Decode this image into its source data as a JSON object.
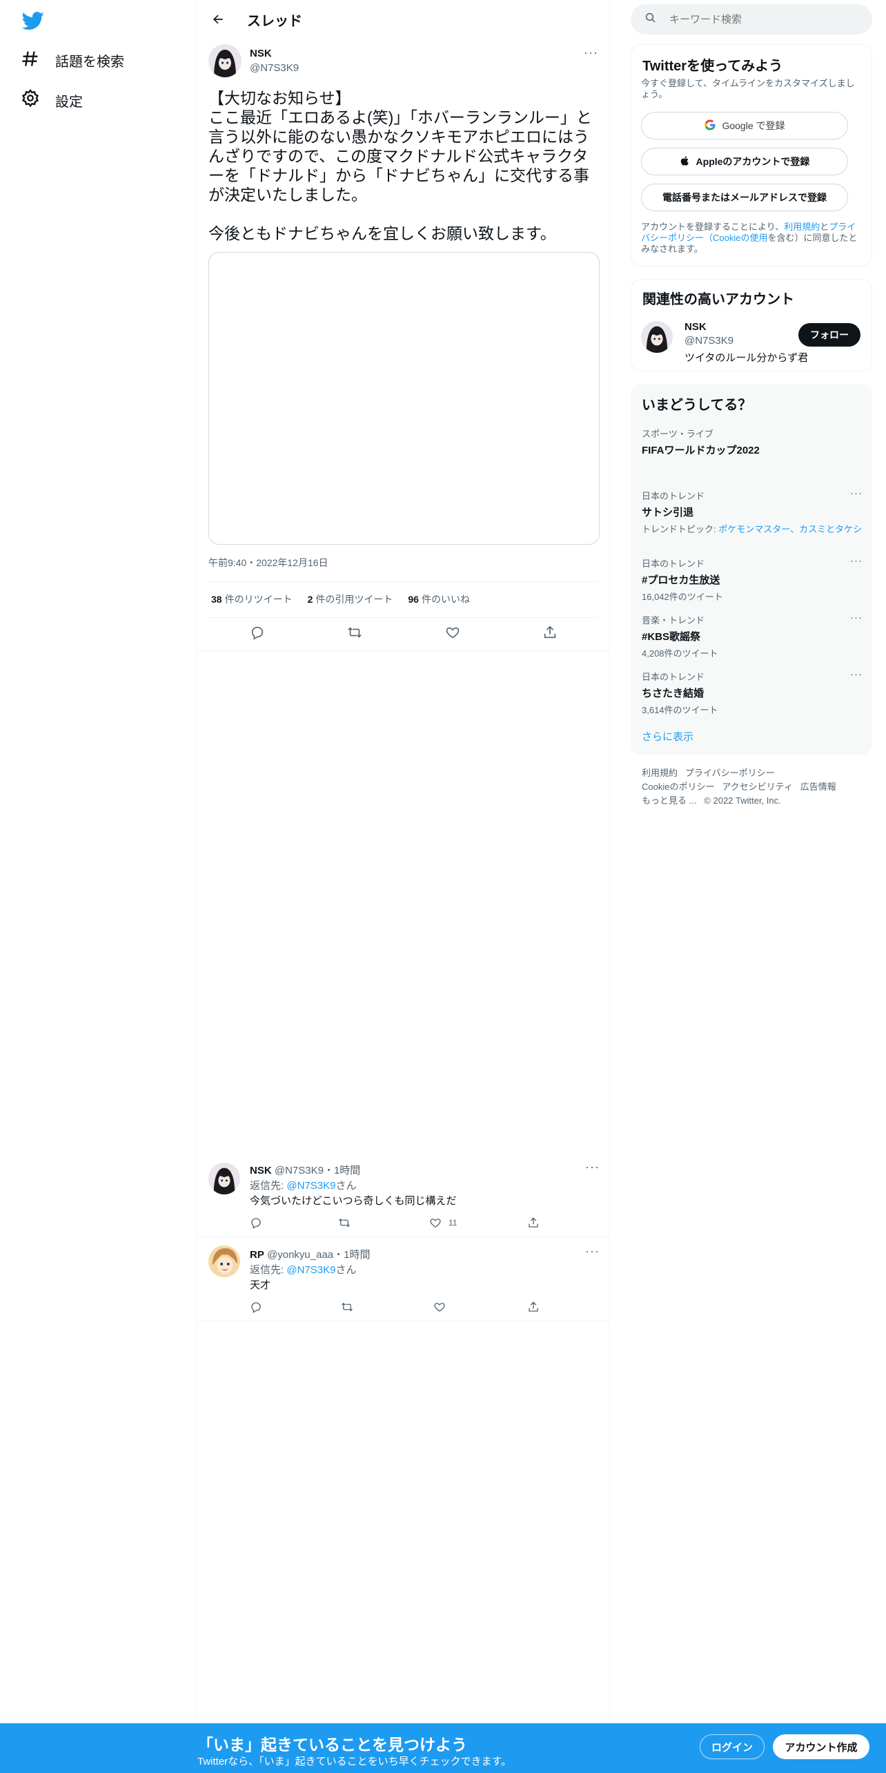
{
  "nav": {
    "explore_label": "話題を検索",
    "settings_label": "設定"
  },
  "thread": {
    "title": "スレッド",
    "tweet": {
      "name": "NSK",
      "handle": "@N7S3K9",
      "text_p1": "【大切なお知らせ】\nここ最近「エロあるよ(笑)」「ホバーランランルー」と言う以外に能のない愚かなクソキモアホピエロにはうんざりですので、この度マクドナルド公式キャラクターを「ドナルド」から「ドナビちゃん」に交代する事が決定いたしました。",
      "text_p2": "今後ともドナビちゃんを宜しくお願い致します。",
      "timestamp": "午前9:40・2022年12月16日",
      "retweets_count": "38",
      "retweets_label": "件のリツイート",
      "quotes_count": "2",
      "quotes_label": "件の引用ツイート",
      "likes_count": "96",
      "likes_label": "件のいいね"
    },
    "replies": [
      {
        "name": "NSK",
        "handle": "@N7S3K9",
        "time": "・1時間",
        "reply_to_prefix": "返信先: ",
        "reply_to_mention": "@N7S3K9",
        "reply_to_suffix": "さん",
        "text": "今気づいたけどこいつら奇しくも同じ構えだ",
        "likes": "11"
      },
      {
        "name": "RP",
        "handle": "@yonkyu_aaa",
        "time": "・1時間",
        "reply_to_prefix": "返信先: ",
        "reply_to_mention": "@N7S3K9",
        "reply_to_suffix": "さん",
        "text": "天才",
        "likes": ""
      }
    ]
  },
  "search": {
    "placeholder": "キーワード検索"
  },
  "signup_card": {
    "title": "Twitterを使ってみよう",
    "subtitle": "今すぐ登録して、タイムラインをカスタマイズしましょう。",
    "google_label": "Google で登録",
    "apple_label": "Appleのアカウントで登録",
    "phone_label": "電話番号またはメールアドレスで登録",
    "terms_prefix": "アカウントを登録することにより、",
    "terms_link": "利用規約",
    "terms_and": "と",
    "privacy_link": "プライバシーポリシー",
    "cookie_prefix": "（",
    "cookie_link": "Cookieの使用",
    "terms_suffix": "を含む）に同意したとみなされます。"
  },
  "relevant_card": {
    "title": "関連性の高いアカウント",
    "name": "NSK",
    "handle": "@N7S3K9",
    "bio": "ツイタのルール分からず君",
    "follow_label": "フォロー"
  },
  "trends_card": {
    "title": "いまどうしてる？",
    "items": [
      {
        "category": "スポーツ・ライブ",
        "name": "FIFAワールドカップ2022",
        "count": ""
      },
      {
        "category": "日本のトレンド",
        "name": "サトシ引退",
        "topic_prefix": "トレンドトピック: ",
        "topic_links": "ポケモンマスター、カスミとタケシ",
        "count": ""
      },
      {
        "category": "日本のトレンド",
        "name": "#プロセカ生放送",
        "count": "16,042件のツイート"
      },
      {
        "category": "音楽・トレンド",
        "name": "#KBS歌謡祭",
        "count": "4,208件のツイート"
      },
      {
        "category": "日本のトレンド",
        "name": "ちさたき結婚",
        "count": "3,614件のツイート"
      }
    ],
    "show_more": "さらに表示"
  },
  "footer": {
    "terms": "利用規約",
    "privacy": "プライバシーポリシー",
    "cookie": "Cookieのポリシー",
    "accessibility": "アクセシビリティ",
    "ads": "広告情報",
    "more": "もっと見る ...",
    "copyright": "© 2022 Twitter, Inc."
  },
  "bottom_bar": {
    "title": "「いま」起きていることを見つけよう",
    "subtitle": "Twitterなら、「いま」起きていることをいち早くチェックできます。",
    "login_label": "ログイン",
    "signup_label": "アカウント作成"
  },
  "colors": {
    "brand": "#1d9bf0",
    "text": "#0f1419",
    "secondary": "#536471"
  }
}
